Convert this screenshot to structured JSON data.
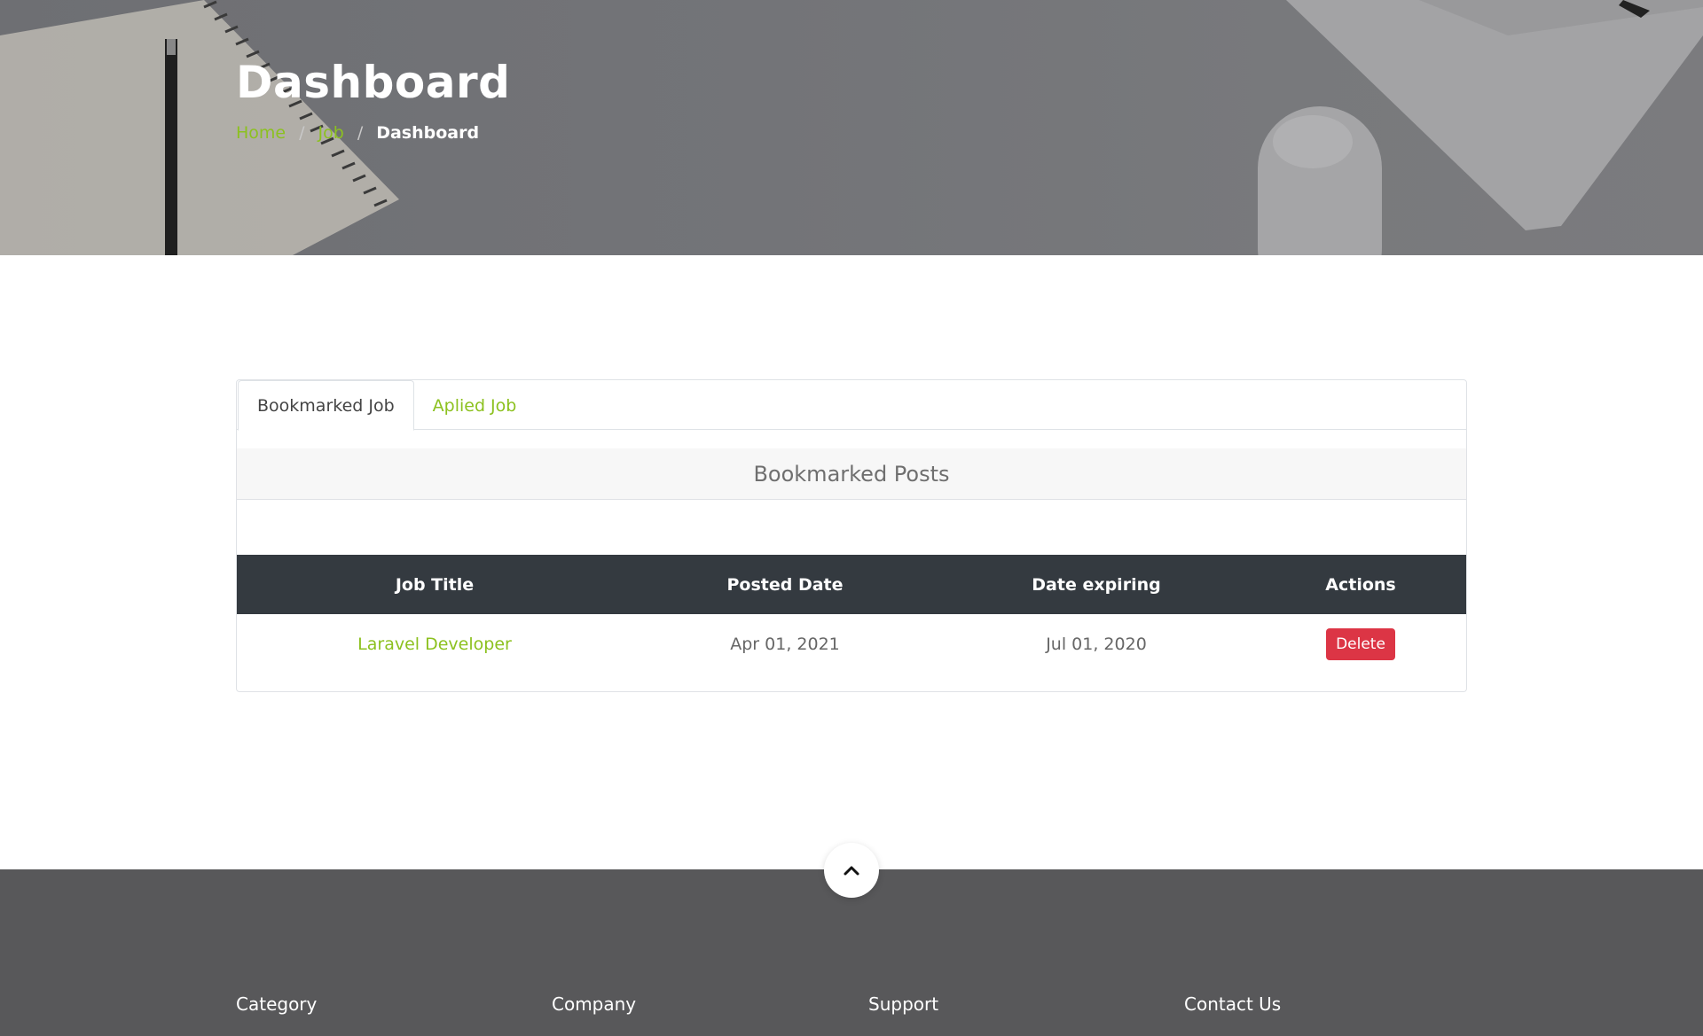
{
  "hero": {
    "title": "Dashboard",
    "breadcrumb": [
      {
        "label": "Home"
      },
      {
        "label": "Job"
      },
      {
        "label": "Dashboard"
      }
    ]
  },
  "tabs": [
    {
      "label": "Bookmarked Job",
      "active": true
    },
    {
      "label": "Aplied Job",
      "active": false
    }
  ],
  "panel": {
    "heading": "Bookmarked Posts"
  },
  "table": {
    "columns": [
      "Job Title",
      "Posted Date",
      "Date expiring",
      "Actions"
    ],
    "rows": [
      {
        "job_title": "Laravel Developer",
        "posted_date": "Apr 01, 2021",
        "date_expiring": "Jul 01, 2020",
        "action_label": "Delete"
      }
    ]
  },
  "footer": {
    "columns": [
      "Category",
      "Company",
      "Support",
      "Contact Us"
    ]
  },
  "scroll_top_icon": "chevron-up-icon",
  "colors": {
    "accent": "#8cc11f",
    "danger": "#dc3545",
    "table_header": "#343a40",
    "footer_bg": "#58585a"
  }
}
